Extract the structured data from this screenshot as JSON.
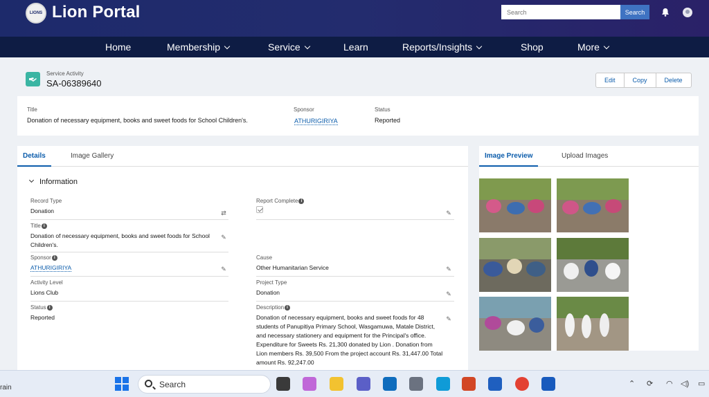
{
  "header": {
    "brand": "Lion Portal",
    "logo_text": "LIONS",
    "search_placeholder": "Search",
    "search_button": "Search"
  },
  "nav": {
    "home": "Home",
    "membership": "Membership",
    "service": "Service",
    "learn": "Learn",
    "reports": "Reports/Insights",
    "shop": "Shop",
    "more": "More"
  },
  "record": {
    "type_label": "Service Activity",
    "id": "SA-06389640",
    "actions": {
      "edit": "Edit",
      "copy": "Copy",
      "delete": "Delete"
    }
  },
  "highlights": {
    "title_label": "Title",
    "title_value": "Donation of necessary equipment, books and sweet foods for School Children's.",
    "sponsor_label": "Sponsor",
    "sponsor_value": "ATHURIGIRIYA",
    "status_label": "Status",
    "status_value": "Reported"
  },
  "details": {
    "tabs": {
      "details": "Details",
      "gallery": "Image Gallery"
    },
    "section_title": "Information",
    "record_type_label": "Record Type",
    "record_type_value": "Donation",
    "report_complete_label": "Report Complete",
    "report_complete_checked": true,
    "title_label": "Title",
    "title_value": "Donation of necessary equipment, books and sweet foods for School Children's.",
    "sponsor_label": "Sponsor",
    "sponsor_value": "ATHURIGIRIYA",
    "cause_label": "Cause",
    "cause_value": "Other Humanitarian Service",
    "activity_level_label": "Activity Level",
    "activity_level_value": "Lions Club",
    "project_type_label": "Project Type",
    "project_type_value": "Donation",
    "status_label": "Status",
    "status_value": "Reported",
    "description_label": "Description",
    "description_value": "Donation of necessary equipment, books and sweet foods for 48 students of Panupitiya Primary School, Wasgamuwa, Matale District, and necessary stationery and equipment for the Principal's office. Expenditure for Sweets Rs. 21,300 donated by Lion . Donation from Lion members Rs. 39,500 From the project account Rs. 31,447.00 Total amount Rs. 92,247.00"
  },
  "image_panel": {
    "tabs": {
      "preview": "Image Preview",
      "upload": "Upload Images"
    }
  },
  "taskbar": {
    "weather_text": "rain",
    "search_text": "Search"
  },
  "colors": {
    "header_bg": "#1d2a6b",
    "nav_bg": "#0e1c44",
    "accent": "#0b5cab",
    "record_icon": "#3ab5a3"
  }
}
